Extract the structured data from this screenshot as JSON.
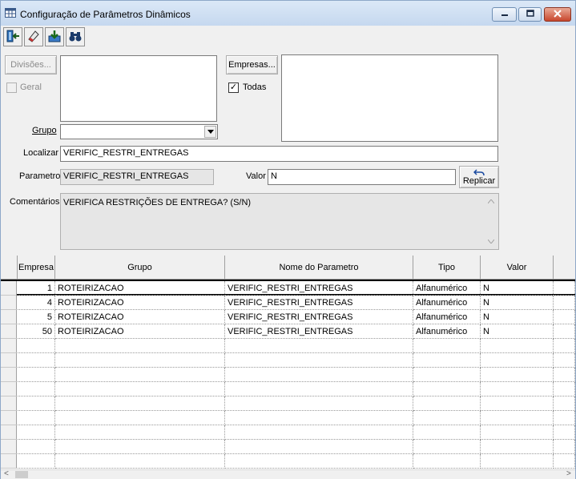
{
  "window": {
    "title": "Configuração de Parâmetros Dinâmicos"
  },
  "toolbar": {
    "buttons": [
      {
        "icon": "exit-icon"
      },
      {
        "icon": "eraser-icon"
      },
      {
        "icon": "save-icon"
      },
      {
        "icon": "binoculars-icon"
      }
    ]
  },
  "form": {
    "divisoes_label": "Divisões...",
    "geral_label": "Geral",
    "geral_checked": false,
    "empresas_label": "Empresas...",
    "todas_label": "Todas",
    "todas_checked": true,
    "todas_mark": "✓",
    "grupo_label": "Grupo",
    "grupo_value": "",
    "localizar_label": "Localizar",
    "localizar_value": "VERIFIC_RESTRI_ENTREGAS",
    "parametro_label": "Parametro",
    "parametro_value": "VERIFIC_RESTRI_ENTREGAS",
    "valor_label": "Valor",
    "valor_value": "N",
    "replicar_label": "Replicar",
    "comentarios_label": "Comentários",
    "comentarios_value": "VERIFICA RESTRIÇÕES DE ENTREGA? (S/N)"
  },
  "grid": {
    "columns": [
      "Empresa",
      "Grupo",
      "Nome do Parametro",
      "Tipo",
      "Valor"
    ],
    "rows": [
      {
        "empresa": "1",
        "grupo": "ROTEIRIZACAO",
        "nome": "VERIFIC_RESTRI_ENTREGAS",
        "tipo": "Alfanumérico",
        "valor": "N"
      },
      {
        "empresa": "4",
        "grupo": "ROTEIRIZACAO",
        "nome": "VERIFIC_RESTRI_ENTREGAS",
        "tipo": "Alfanumérico",
        "valor": "N"
      },
      {
        "empresa": "5",
        "grupo": "ROTEIRIZACAO",
        "nome": "VERIFIC_RESTRI_ENTREGAS",
        "tipo": "Alfanumérico",
        "valor": "N"
      },
      {
        "empresa": "50",
        "grupo": "ROTEIRIZACAO",
        "nome": "VERIFIC_RESTRI_ENTREGAS",
        "tipo": "Alfanumérico",
        "valor": "N"
      }
    ],
    "selected_row": 0
  },
  "scrollbar": {
    "left_arrow": "<",
    "right_arrow": ">"
  },
  "colors": {
    "titlebar": "#c5d8ef",
    "close_button": "#c8472d",
    "selected_row_border": "#000000"
  }
}
